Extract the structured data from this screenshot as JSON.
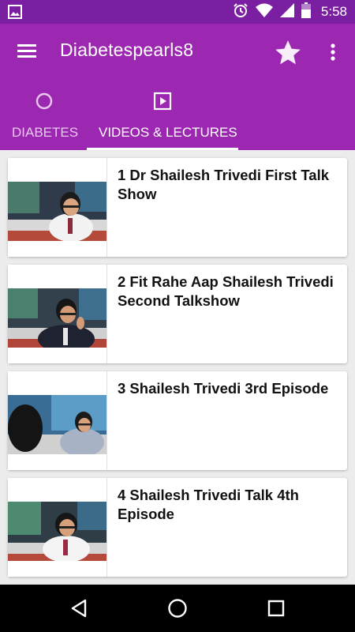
{
  "status_bar": {
    "time": "5:58",
    "icons": [
      "image-icon",
      "alarm-icon",
      "wifi-icon",
      "signal-icon",
      "battery-icon"
    ]
  },
  "app_bar": {
    "title": "Diabetespearls8",
    "icons": [
      "menu-icon",
      "star-icon",
      "more-vert-icon"
    ]
  },
  "tabs": [
    {
      "label": "DIABETES",
      "icon": "circle-icon",
      "selected": false
    },
    {
      "label": "VIDEOS & LECTURES",
      "icon": "play-box-icon",
      "selected": true
    }
  ],
  "videos": [
    {
      "title": "1 Dr Shailesh Trivedi First Talk Show"
    },
    {
      "title": "2 Fit Rahe Aap Shailesh Trivedi Second Talkshow"
    },
    {
      "title": "3 Shailesh Trivedi 3rd Episode"
    },
    {
      "title": "4 Shailesh Trivedi Talk 4th Episode"
    }
  ],
  "nav_bar": {
    "icons": [
      "back-icon",
      "home-icon",
      "recents-icon"
    ]
  },
  "colors": {
    "status_bar": "#7b1fa2",
    "app_bar": "#9c27b0",
    "background": "#ececec",
    "card": "#ffffff",
    "nav_bar": "#000000"
  }
}
